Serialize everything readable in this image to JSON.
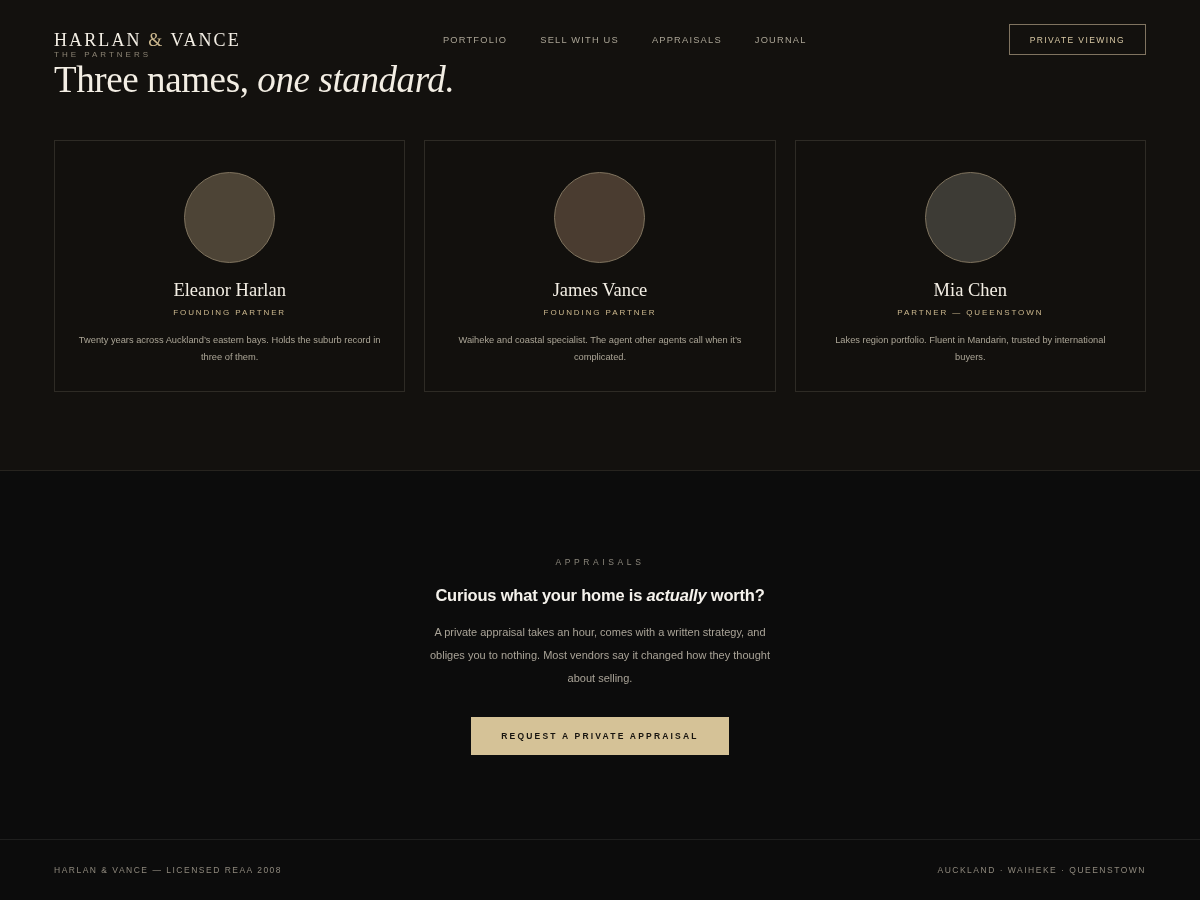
{
  "header": {
    "logo": {
      "first": "HARLAN",
      "joiner": "&",
      "second": "VANCE"
    },
    "nav": [
      "PORTFOLIO",
      "SELL WITH US",
      "APPRAISALS",
      "JOURNAL"
    ],
    "cta": "PRIVATE VIEWING"
  },
  "partners": {
    "eyebrow": "THE PARTNERS",
    "heading": "Three names, *one standard.*",
    "members": [
      {
        "name": "Eleanor Harlan",
        "role": "FOUNDING PARTNER",
        "bio": "Twenty years across Auckland’s eastern bays. Holds the suburb record in three of them.",
        "color": "#4d4436"
      },
      {
        "name": "James Vance",
        "role": "FOUNDING PARTNER",
        "bio": "Waiheke and coastal specialist. The agent other agents call when it’s complicated.",
        "color": "#4a3c30"
      },
      {
        "name": "Mia Chen",
        "role": "PARTNER — QUEENSTOWN",
        "bio": "Lakes region portfolio. Fluent in Mandarin, trusted by international buyers.",
        "color": "#3d3b35"
      }
    ]
  },
  "appraisal": {
    "eyebrow": "APPRAISALS",
    "heading": "Curious what your home is *actually* worth?",
    "body": "A private appraisal takes an hour, comes with a written strategy, and obliges you to nothing. Most vendors say it changed how they thought about selling.",
    "button": "REQUEST A PRIVATE APPRAISAL"
  },
  "footer": {
    "left": "HARLAN & VANCE — LICENSED REAA 2008",
    "right": "AUCKLAND · WAIHEKE · QUEENSTOWN"
  }
}
